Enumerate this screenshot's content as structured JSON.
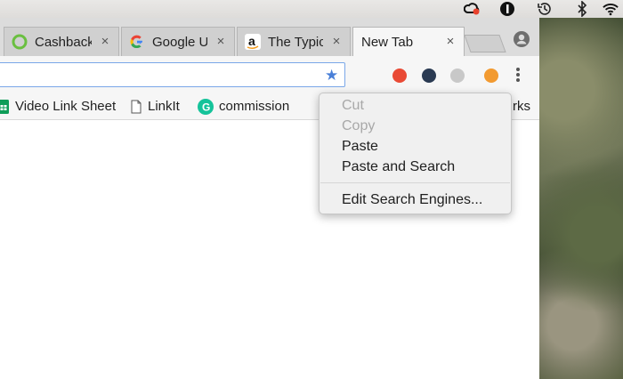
{
  "menubar": {
    "icons": [
      "creative-cloud-icon",
      "onepassword-icon",
      "time-machine-icon",
      "bluetooth-icon",
      "wifi-icon"
    ]
  },
  "tabs": [
    {
      "title": "Cashback",
      "favicon": "cashback-ring-icon",
      "active": false
    },
    {
      "title": "Google U",
      "favicon": "google-g-icon",
      "active": false
    },
    {
      "title": "The Typic",
      "favicon": "amazon-icon",
      "active": false
    },
    {
      "title": "New Tab",
      "favicon": "",
      "active": true
    }
  ],
  "tab_close_glyph": "×",
  "bookmarks": [
    {
      "label": "Video Link Sheet",
      "icon": "sheets-icon"
    },
    {
      "label": "LinkIt",
      "icon": "page-icon"
    },
    {
      "label": "commission",
      "icon": "grammarly-icon"
    },
    {
      "label": "rks",
      "icon": ""
    }
  ],
  "context_menu": {
    "items": [
      {
        "label": "Cut",
        "enabled": false
      },
      {
        "label": "Copy",
        "enabled": false
      },
      {
        "label": "Paste",
        "enabled": true
      },
      {
        "label": "Paste and Search",
        "enabled": true
      },
      {
        "label": "Edit Search Engines...",
        "enabled": true
      }
    ]
  },
  "colors": {
    "omnibox_focus": "#7aa7e8",
    "google_blue": "#4285f4",
    "cashback_green": "#6abf40",
    "grammarly_green": "#15c39a",
    "sheets_green": "#0f9d58"
  }
}
